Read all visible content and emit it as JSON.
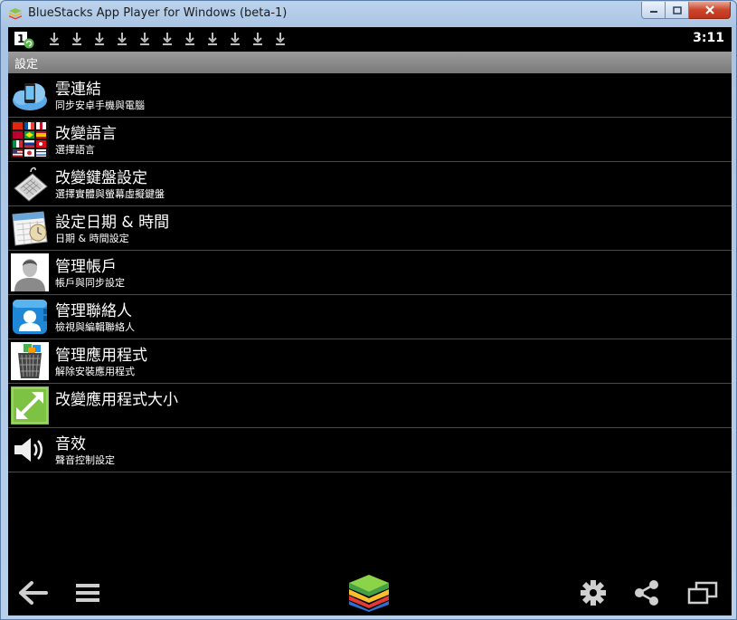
{
  "window": {
    "title": "BlueStacks App Player for Windows (beta-1)"
  },
  "statusbar": {
    "notification_badge": "1",
    "download_count": 11,
    "clock": "3:11"
  },
  "actionbar": {
    "title": "設定"
  },
  "settings": {
    "items": [
      {
        "title": "雲連結",
        "subtitle": "同步安卓手機與電腦",
        "icon": "cloud-phone-icon"
      },
      {
        "title": "改變語言",
        "subtitle": "選擇語言",
        "icon": "flags-icon"
      },
      {
        "title": "改變鍵盤設定",
        "subtitle": "選擇實體與螢幕虛擬鍵盤",
        "icon": "keyboard-icon"
      },
      {
        "title": "設定日期 & 時間",
        "subtitle": "日期 & 時間設定",
        "icon": "calendar-icon"
      },
      {
        "title": "管理帳戶",
        "subtitle": "帳戶與同步設定",
        "icon": "account-icon"
      },
      {
        "title": "管理聯絡人",
        "subtitle": "檢視與編輯聯絡人",
        "icon": "contacts-icon"
      },
      {
        "title": "管理應用程式",
        "subtitle": "解除安裝應用程式",
        "icon": "trash-icon"
      },
      {
        "title": "改變應用程式大小",
        "subtitle": "",
        "icon": "resize-icon"
      },
      {
        "title": "音效",
        "subtitle": "聲音控制設定",
        "icon": "speaker-icon"
      }
    ]
  },
  "navbar": {
    "buttons": [
      "back-icon",
      "menu-icon",
      "bluestacks-logo-icon",
      "settings-gear-icon",
      "share-icon",
      "window-resize-icon"
    ]
  }
}
